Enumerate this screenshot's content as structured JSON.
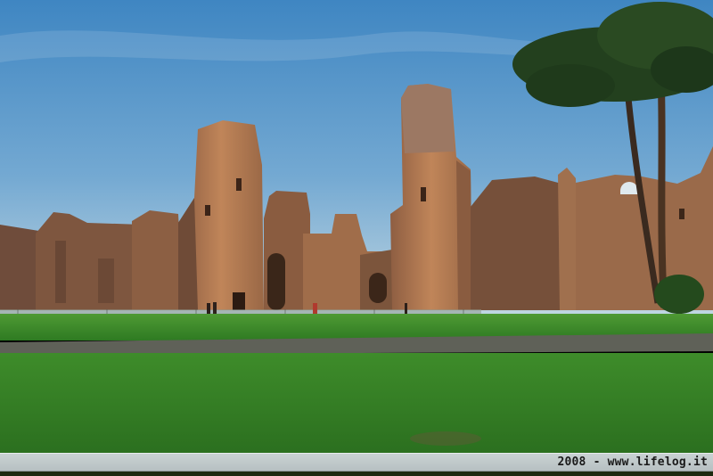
{
  "photo": {
    "watermark": "2008 - www.lifelog.it",
    "colors": {
      "sky_top": "#4a8fc6",
      "sky_bottom": "#b9d3e0",
      "ruin_lit": "#b67a52",
      "ruin_shadow": "#6e4d3a",
      "grass": "#3f8f2c",
      "path": "#5f5f55",
      "pine_canopy": "#1f3d1c"
    }
  }
}
